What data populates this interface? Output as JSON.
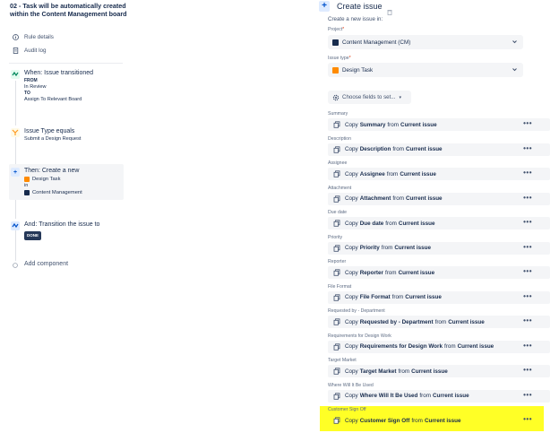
{
  "rule": {
    "title": "02 - Task will be automatically created within the Content Management board",
    "nav": [
      {
        "label": "Rule details",
        "icon": "info-icon"
      },
      {
        "label": "Audit log",
        "icon": "document-icon"
      }
    ]
  },
  "steps": {
    "trigger": {
      "title": "When: Issue transitioned",
      "from_label": "FROM",
      "from_value": "In Review",
      "to_label": "TO",
      "to_value": "Assign To Relevant Board"
    },
    "condition": {
      "title": "Issue Type equals",
      "value": "Submit a Design Request"
    },
    "action_create": {
      "title": "Then: Create a new",
      "issue_type": "Design Task",
      "in_label": "in",
      "project": "Content Management"
    },
    "action_transition": {
      "title": "And: Transition the issue to",
      "status": "DONE"
    },
    "add_component": "Add component"
  },
  "panel": {
    "title": "Create issue",
    "subtitle": "Create a new issue in:",
    "project_label": "Project",
    "project_value": "Content Management (CM)",
    "issue_type_label": "Issue type",
    "issue_type_value": "Design Task",
    "required_mark": "*",
    "choose_fields": "Choose fields to set...",
    "copy_word": "Copy",
    "from_word": "from",
    "current_issue": "Current issue",
    "fields": [
      {
        "label": "Summary",
        "field": "Summary"
      },
      {
        "label": "Description",
        "field": "Description"
      },
      {
        "label": "Assignee",
        "field": "Assignee"
      },
      {
        "label": "Attachment",
        "field": "Attachment"
      },
      {
        "label": "Due date",
        "field": "Due date"
      },
      {
        "label": "Priority",
        "field": "Priority"
      },
      {
        "label": "Reporter",
        "field": "Reporter"
      },
      {
        "label": "File Format",
        "field": "File Format"
      },
      {
        "label": "Requested by - Department",
        "field": "Requested by - Department"
      },
      {
        "label": "Requirements for Design Work",
        "field": "Requirements for Design Work"
      },
      {
        "label": "Target Market",
        "field": "Target Market"
      },
      {
        "label": "Where Will It Be Used",
        "field": "Where Will It Be Used"
      },
      {
        "label": "Customer Sign Off",
        "field": "Customer Sign Off"
      }
    ],
    "more_label": "•••"
  },
  "colors": {
    "highlight": "#ffff26",
    "accent": "#0052cc",
    "design_task": "#ff8b00",
    "project_icon": "#172b4d"
  }
}
